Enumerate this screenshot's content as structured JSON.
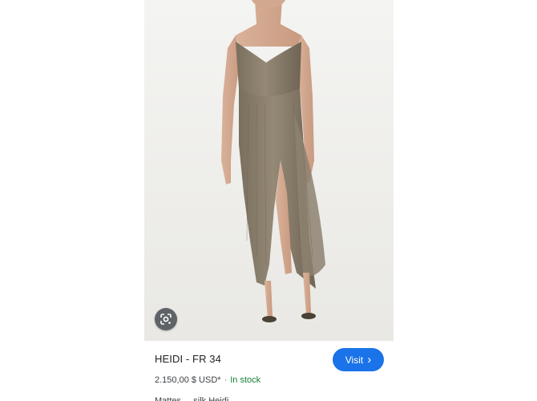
{
  "product": {
    "title": "HEIDI - FR 34",
    "price": "2.150,00 $ USD*",
    "separator": "·",
    "stock_status": "In stock",
    "description_fragment": "Mattes ... silk Heidi ..."
  },
  "actions": {
    "visit_label": "Visit",
    "visit_chevron": "›",
    "lens_icon": "google-lens-icon"
  },
  "colors": {
    "accent": "#1a73e8",
    "in_stock": "#188038",
    "dress": "#8a7d6b"
  }
}
